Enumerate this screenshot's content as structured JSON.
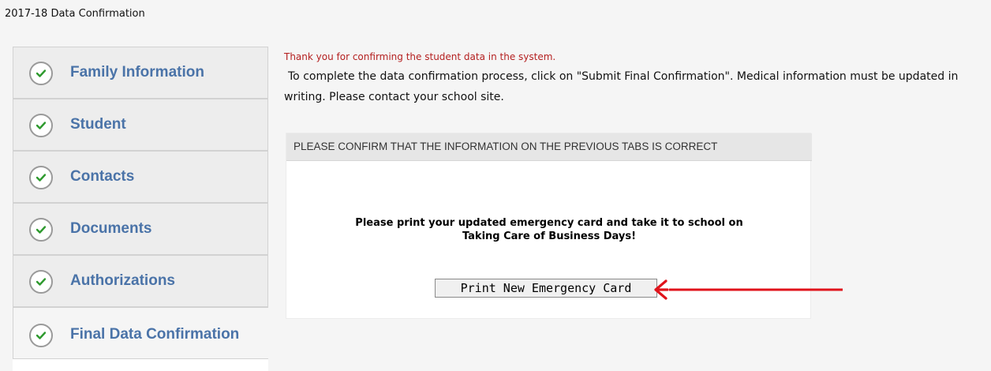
{
  "page": {
    "title": "2017-18 Data Confirmation"
  },
  "sidebar": {
    "items": [
      {
        "label": "Family Information",
        "icon": "check-circle-icon"
      },
      {
        "label": "Student",
        "icon": "check-circle-icon"
      },
      {
        "label": "Contacts",
        "icon": "check-circle-icon"
      },
      {
        "label": "Documents",
        "icon": "check-circle-icon"
      },
      {
        "label": "Authorizations",
        "icon": "check-circle-icon"
      },
      {
        "label": "Final Data Confirmation",
        "icon": "check-circle-icon",
        "active": true
      }
    ]
  },
  "main": {
    "thanks_message": "Thank you for confirming the student data in the system.",
    "instructions": "To complete the data confirmation process, click on \"Submit Final Confirmation\". Medical information must be updated in writing. Please contact your school site.",
    "confirm_panel": {
      "header": "PLEASE CONFIRM THAT THE INFORMATION ON THE PREVIOUS TABS IS CORRECT",
      "print_note_line1": "Please print your updated emergency card and take it to school on",
      "print_note_line2": "Taking Care of Business Days!",
      "print_button_label": "Print New Emergency Card"
    }
  },
  "colors": {
    "sidebar_label": "#4a73a8",
    "check": "#2e9a2e",
    "thanks_text": "#b41f1f",
    "arrow": "#e0131b"
  },
  "annotation": {
    "icon": "red-arrow-icon"
  }
}
